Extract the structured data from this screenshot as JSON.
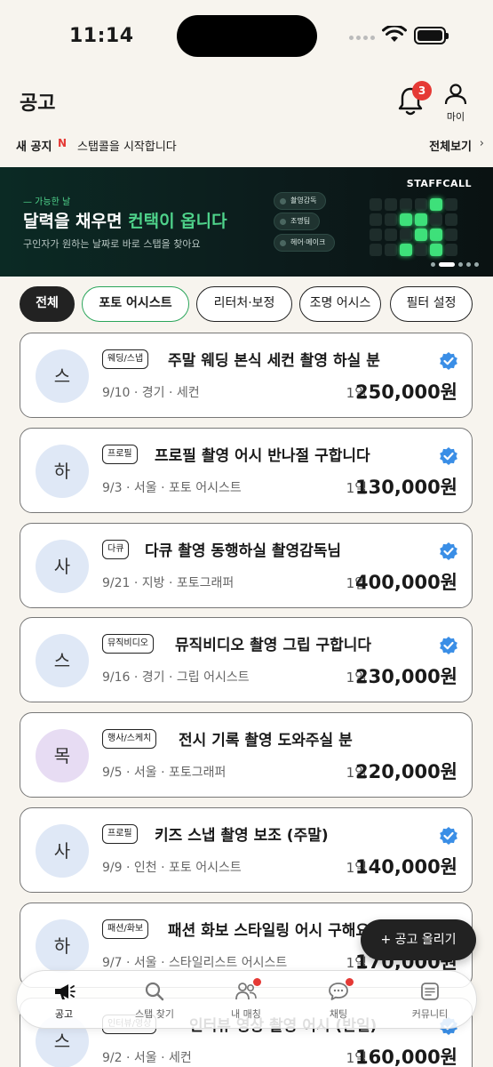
{
  "status": {
    "time": "11:14"
  },
  "header": {
    "title": "공고",
    "bell_badge": "3",
    "my_label": "마이"
  },
  "notice": {
    "label": "새 공지",
    "new_mark": "N",
    "text": "스탭콜을 시작합니다",
    "view_all": "전체보기",
    "chevron": "›"
  },
  "banner": {
    "tag": "— 가능한 날",
    "headline_pre": "달력을 채우면 ",
    "headline_accent": "컨택이 옵니다",
    "subtitle": "구인자가 원하는 날짜로 바로 스탭을 찾아요",
    "brand": "STAFFCALL",
    "chips": [
      "촬영감독",
      "조명팀",
      "헤어·메이크"
    ],
    "accent_color": "#4fd38b"
  },
  "filters": [
    "전체",
    "포토 어시스트",
    "리터처·보정",
    "조명 어시스",
    "필터 설정"
  ],
  "jobs": [
    {
      "avatar": "스",
      "category": "웨딩/스냅",
      "title": "주말 웨딩 본식 세컨 촬영 하실 분",
      "meta": "9/10 · 경기 · 세컨",
      "period": "1일",
      "pay": "250,000원",
      "verified": true
    },
    {
      "avatar": "하",
      "category": "프로필",
      "title": "프로필 촬영 어시 반나절 구합니다",
      "meta": "9/3 · 서울 · 포토 어시스트",
      "period": "1일",
      "pay": "130,000원",
      "verified": true
    },
    {
      "avatar": "사",
      "category": "다큐",
      "title": "다큐 촬영 동행하실 촬영감독님",
      "meta": "9/21 · 지방 · 포토그래퍼",
      "period": "1일",
      "pay": "400,000원",
      "verified": true
    },
    {
      "avatar": "스",
      "category": "뮤직비디오",
      "title": "뮤직비디오 촬영 그립 구합니다",
      "meta": "9/16 · 경기 · 그립 어시스트",
      "period": "1일",
      "pay": "230,000원",
      "verified": true
    },
    {
      "avatar": "목",
      "category": "행사/스케치",
      "title": "전시 기록 촬영 도와주실 분",
      "meta": "9/5 · 서울 · 포토그래퍼",
      "period": "1일",
      "pay": "220,000원",
      "verified": false
    },
    {
      "avatar": "사",
      "category": "프로필",
      "title": "키즈 스냅 촬영 보조 (주말)",
      "meta": "9/9 · 인천 · 포토 어시스트",
      "period": "1일",
      "pay": "140,000원",
      "verified": true
    },
    {
      "avatar": "하",
      "category": "패션/화보",
      "title": "패션 화보 스타일링 어시 구해요",
      "meta": "9/7 · 서울 · 스타일리스트 어시스트",
      "period": "1일",
      "pay": "170,000원",
      "verified": false
    },
    {
      "avatar": "스",
      "category": "인터뷰/영상",
      "title": "인터뷰 영상 촬영 어시 (반일)",
      "meta": "9/2 · 서울 · 세컨",
      "period": "1일",
      "pay": "160,000원",
      "verified": true
    }
  ],
  "fab": {
    "label": "+ 공고 올리기"
  },
  "tabs": [
    {
      "label": "공고",
      "icon": "megaphone-icon"
    },
    {
      "label": "스탭 찾기",
      "icon": "search-icon"
    },
    {
      "label": "내 매칭",
      "icon": "people-icon"
    },
    {
      "label": "채팅",
      "icon": "chat-icon"
    },
    {
      "label": "커뮤니티",
      "icon": "board-icon"
    }
  ],
  "colors": {
    "background": "#f7f4ee",
    "accent_green": "#2aa55a",
    "badge_red": "#e53935",
    "verify_blue": "#3a8ee6"
  }
}
